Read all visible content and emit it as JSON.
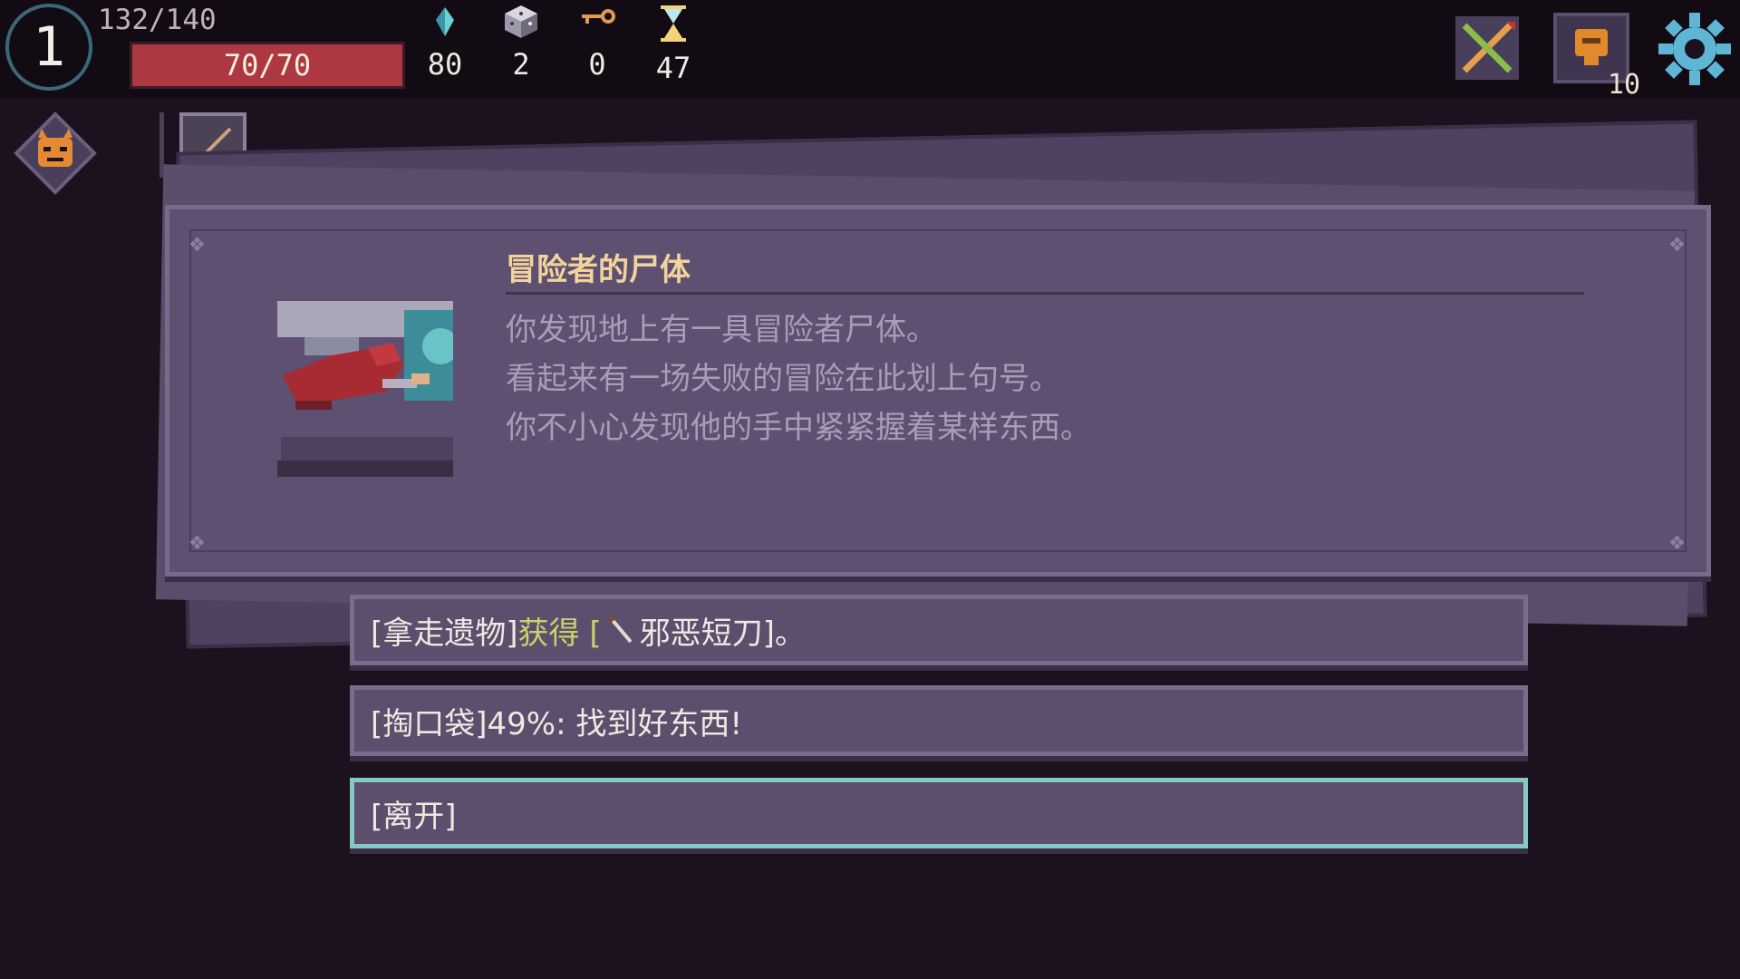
{
  "hud": {
    "level": "1",
    "xp": "132/140",
    "hp": "70/70",
    "resources": [
      {
        "icon": "crystal-icon",
        "value": "80"
      },
      {
        "icon": "dice-icon",
        "value": "2"
      },
      {
        "icon": "key-icon",
        "value": "0"
      },
      {
        "icon": "hourglass-icon",
        "value": "47"
      }
    ],
    "right": {
      "weapon_icon": "crossed-weapons-icon",
      "inventory_icon": "bag-icon",
      "inventory_count": "10",
      "settings_icon": "gear-icon"
    }
  },
  "sidebar": {
    "mask_icon": "demon-mask-icon",
    "equipped_icon": "sword-icon"
  },
  "event": {
    "title": "冒险者的尸体",
    "lines": [
      "你发现地上有一具冒险者尸体。",
      "看起来有一场失败的冒险在此划上句号。",
      "你不小心发现他的手中紧紧握着某样东西。"
    ]
  },
  "choices": [
    {
      "bracket": "[拿走遗物]",
      "green": " 获得 [",
      "item_icon": "dagger-icon",
      "rest": "邪恶短刀]。"
    },
    {
      "bracket": "[掏口袋]",
      "rest": " 49%: 找到好东西!"
    },
    {
      "bracket": "[离开]",
      "rest": ""
    }
  ],
  "colors": {
    "background": "#1c121f",
    "panel": "#5e5070",
    "hp_bar": "#ad3842",
    "title": "#f2d39b",
    "highlight": "#c8d36c",
    "selected_border": "#86c9c4"
  }
}
